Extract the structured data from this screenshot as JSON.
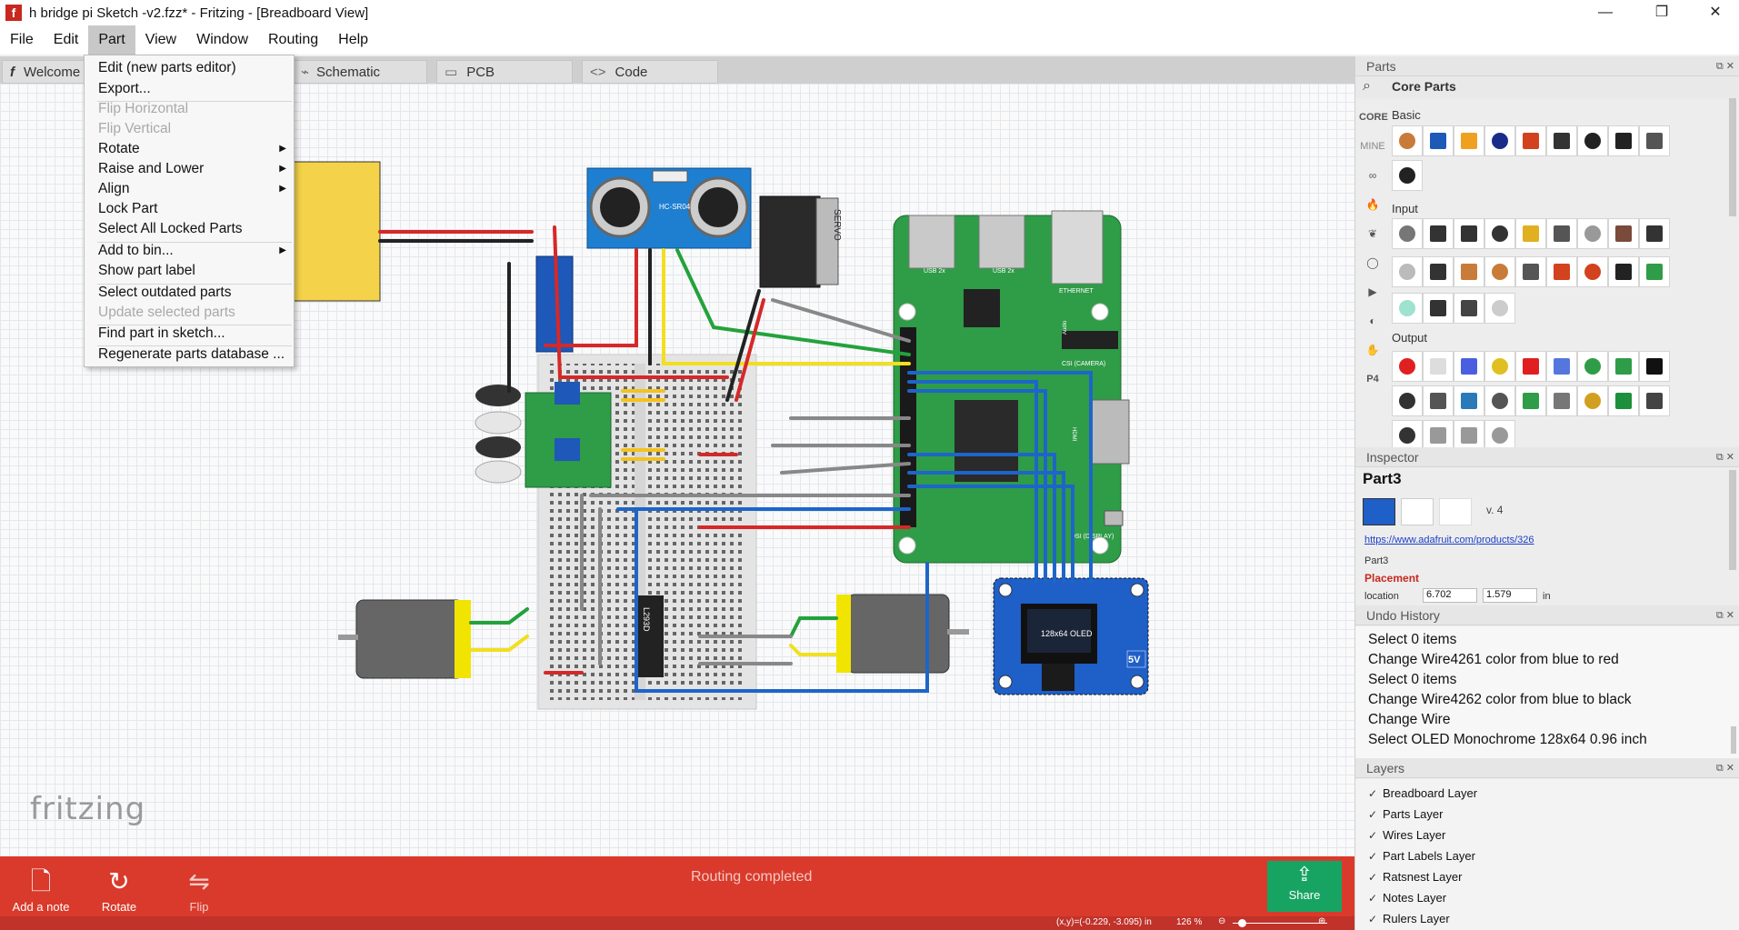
{
  "window": {
    "title": "h bridge pi Sketch -v2.fzz* - Fritzing - [Breadboard View]",
    "app_icon": "f",
    "minimize": "—",
    "maximize": "❐",
    "close": "✕"
  },
  "menubar": {
    "items": [
      {
        "label": "File"
      },
      {
        "label": "Edit"
      },
      {
        "label": "Part",
        "active": true
      },
      {
        "label": "View"
      },
      {
        "label": "Window"
      },
      {
        "label": "Routing"
      },
      {
        "label": "Help"
      }
    ]
  },
  "tabs": [
    {
      "label": "Welcome",
      "icon": "fritzing-icon"
    },
    {
      "label": "Schematic",
      "icon": "schematic-icon"
    },
    {
      "label": "PCB",
      "icon": "pcb-icon"
    },
    {
      "label": "Code",
      "icon": "code-icon"
    }
  ],
  "part_menu": {
    "items": [
      {
        "label": "Edit (new parts editor)",
        "disabled": false,
        "submenu": false
      },
      {
        "label": "Export...",
        "disabled": false,
        "submenu": false
      },
      {
        "label": "Flip Horizontal",
        "disabled": true,
        "submenu": false
      },
      {
        "label": "Flip Vertical",
        "disabled": true,
        "submenu": false
      },
      {
        "label": "Rotate",
        "disabled": false,
        "submenu": true
      },
      {
        "label": "Raise and Lower",
        "disabled": false,
        "submenu": true
      },
      {
        "label": "Align",
        "disabled": false,
        "submenu": true
      },
      {
        "label": "Lock Part",
        "disabled": false,
        "submenu": false
      },
      {
        "label": "Select All Locked Parts",
        "disabled": false,
        "submenu": false
      },
      {
        "label": "Add to bin...",
        "disabled": false,
        "submenu": true
      },
      {
        "label": "Show part label",
        "disabled": false,
        "submenu": false
      },
      {
        "label": "Select outdated parts",
        "disabled": false,
        "submenu": false
      },
      {
        "label": "Update selected parts",
        "disabled": true,
        "submenu": false
      },
      {
        "label": "Find part in sketch...",
        "disabled": false,
        "submenu": false
      },
      {
        "label": "Regenerate parts database ...",
        "disabled": false,
        "submenu": false
      }
    ]
  },
  "canvas": {
    "logo": "fritzing",
    "ultrasonic_label": "HC-SR04",
    "servo_label": "SERVO",
    "pi_labels": [
      "USB 2x",
      "USB 2x",
      "ETHERNET",
      "CSI (CAMERA)",
      "Audio",
      "HDMI",
      "DSI (DISPLAY)"
    ],
    "oled_label": "128x64 OLED",
    "oled_5v": "5V",
    "chip_label": "L293D"
  },
  "bottombar": {
    "add_note": "Add a note",
    "rotate": "Rotate",
    "flip": "Flip",
    "status": "Routing completed",
    "share": "Share",
    "coords": "(x,y)=(-0.229, -3.095) in",
    "zoom": "126 %"
  },
  "parts_panel": {
    "title": "Parts",
    "bin_title": "Core Parts",
    "sidebar": [
      "CORE",
      "MINE"
    ],
    "sections": [
      "Basic",
      "Input",
      "Output"
    ]
  },
  "inspector": {
    "title": "Inspector",
    "part_name": "Part3",
    "version": "v. 4",
    "url": "https://www.adafruit.com/products/326",
    "part_sub": "Part3",
    "placement": "Placement",
    "location_label": "location",
    "loc_x": "6.702",
    "loc_y": "1.579",
    "loc_unit": "in"
  },
  "undo_history": {
    "title": "Undo History",
    "items": [
      "Select 0 items",
      "Change Wire4261 color from blue to red",
      "Select 0 items",
      "Change Wire4262 color from blue to black",
      "Change Wire",
      "Select OLED Monochrome 128x64 0.96 inch"
    ]
  },
  "layers": {
    "title": "Layers",
    "items": [
      "Breadboard Layer",
      "Parts Layer",
      "Wires Layer",
      "Part Labels Layer",
      "Ratsnest Layer",
      "Notes Layer",
      "Rulers Layer"
    ]
  },
  "colors": {
    "bottom_bar": "#d93a2b",
    "share_green": "#17a463",
    "pi_green": "#2f9c48",
    "sonar_blue": "#1e7fd0",
    "oled_blue": "#1f5fc8"
  }
}
